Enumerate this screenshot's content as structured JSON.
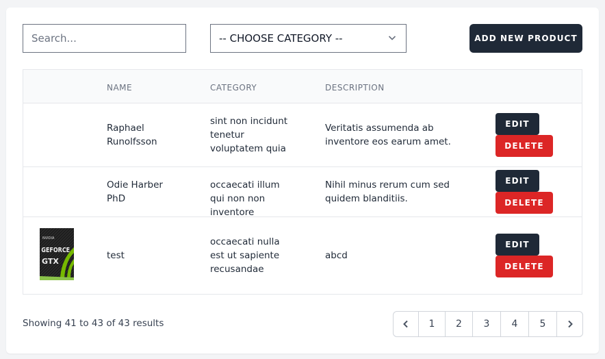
{
  "toolbar": {
    "search_placeholder": "Search...",
    "category_select": "-- CHOOSE CATEGORY --",
    "add_button": "ADD NEW PRODUCT"
  },
  "table": {
    "columns": [
      "",
      "NAME",
      "CATEGORY",
      "DESCRIPTION",
      ""
    ],
    "rows": [
      {
        "name": "Raphael Runolfsson",
        "category": "sint non incidunt tenetur voluptatem quia",
        "description": "Veritatis assumenda ab inventore eos earum amet.",
        "has_image": false
      },
      {
        "name": "Odie Harber PhD",
        "category": "occaecati illum qui non non inventore",
        "description": "Nihil minus rerum cum sed quidem blanditiis.",
        "has_image": false
      },
      {
        "name": "test",
        "category": "occaecati nulla est ut sapiente recusandae",
        "description": "abcd",
        "has_image": true,
        "image_alt": "GeForce GTX"
      }
    ],
    "edit_label": "EDIT",
    "delete_label": "DELETE"
  },
  "footer": {
    "showing": "Showing 41 to 43 of 43 results",
    "pages": [
      "1",
      "2",
      "3",
      "4",
      "5"
    ],
    "prev_icon": "chevron-left-icon",
    "next_icon": "chevron-right-icon"
  },
  "colors": {
    "primary": "#1f2937",
    "danger": "#dc2626",
    "background": "#f3f4f6"
  }
}
